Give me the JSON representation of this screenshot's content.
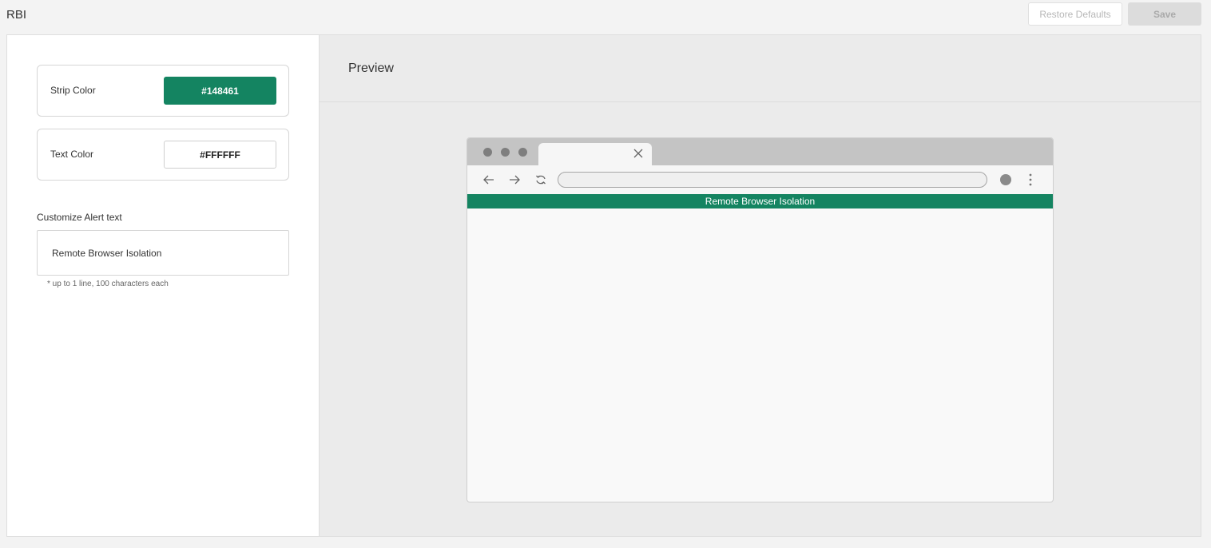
{
  "header": {
    "title": "RBI",
    "restore_label": "Restore Defaults",
    "save_label": "Save"
  },
  "settings": {
    "strip_color": {
      "label": "Strip Color",
      "value": "#148461"
    },
    "text_color": {
      "label": "Text Color",
      "value": "#FFFFFF"
    },
    "alert_text": {
      "label": "Customize Alert text",
      "value": "Remote Browser Isolation",
      "hint": "* up to 1 line, 100 characters each"
    }
  },
  "preview": {
    "title": "Preview",
    "strip_text": "Remote Browser Isolation"
  },
  "icons": {
    "tab_close": "close-icon",
    "back": "arrow-left-icon",
    "forward": "arrow-right-icon",
    "reload": "refresh-icon",
    "profile": "avatar-icon",
    "menu": "kebab-menu-icon"
  }
}
